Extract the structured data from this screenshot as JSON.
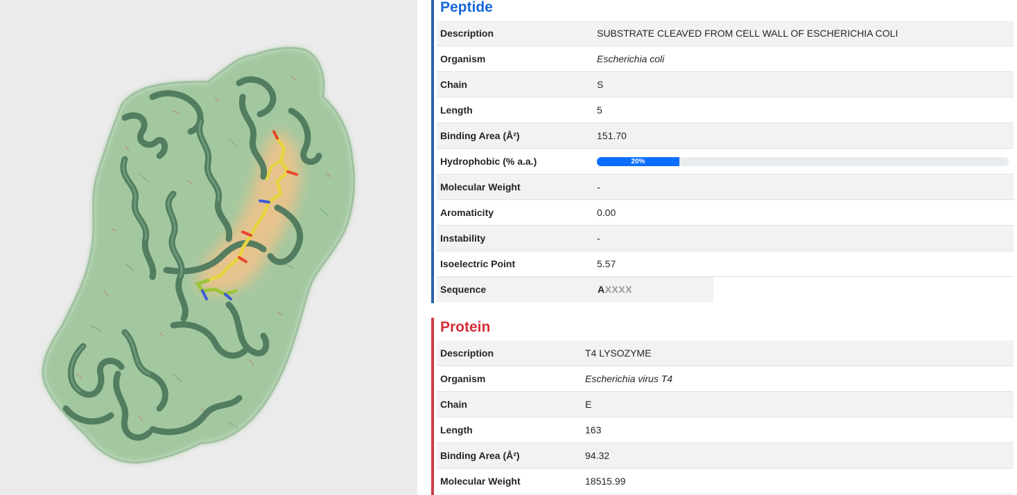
{
  "peptide": {
    "title": "Peptide",
    "accent": "#1766d8",
    "rows": [
      {
        "key": "Description",
        "value": "SUBSTRATE CLEAVED FROM CELL WALL OF ESCHERICHIA COLI"
      },
      {
        "key": "Organism",
        "value": "Escherichia coli"
      },
      {
        "key": "Chain",
        "value": "S"
      },
      {
        "key": "Length",
        "value": "5"
      },
      {
        "key": "Binding Area (Å²)",
        "value": "151.70"
      },
      {
        "key": "Hydrophobic (% a.a.)",
        "value": "20%",
        "fraction": 0.2
      },
      {
        "key": "Molecular Weight",
        "value": "-"
      },
      {
        "key": "Aromaticity",
        "value": "0.00"
      },
      {
        "key": "Instability",
        "value": "-"
      },
      {
        "key": "Isoelectric Point",
        "value": "5.57"
      },
      {
        "key": "Sequence",
        "seq_first": "A",
        "seq_rest": "XXXX"
      }
    ]
  },
  "protein": {
    "title": "Protein",
    "accent": "#d2303b",
    "rows": [
      {
        "key": "Description",
        "value": "T4 LYSOZYME"
      },
      {
        "key": "Organism",
        "value": "Escherichia virus T4"
      },
      {
        "key": "Chain",
        "value": "E"
      },
      {
        "key": "Length",
        "value": "163"
      },
      {
        "key": "Binding Area (Å²)",
        "value": "94.32"
      },
      {
        "key": "Molecular Weight",
        "value": "18515.99"
      }
    ]
  },
  "viewer": {
    "icon": "protein-structure-3d",
    "surface_color": "#8fbf8c",
    "ribbon_color": "#4f7a5d",
    "binding_color": "#f3c28a",
    "ligand_color": "#e8d442"
  }
}
